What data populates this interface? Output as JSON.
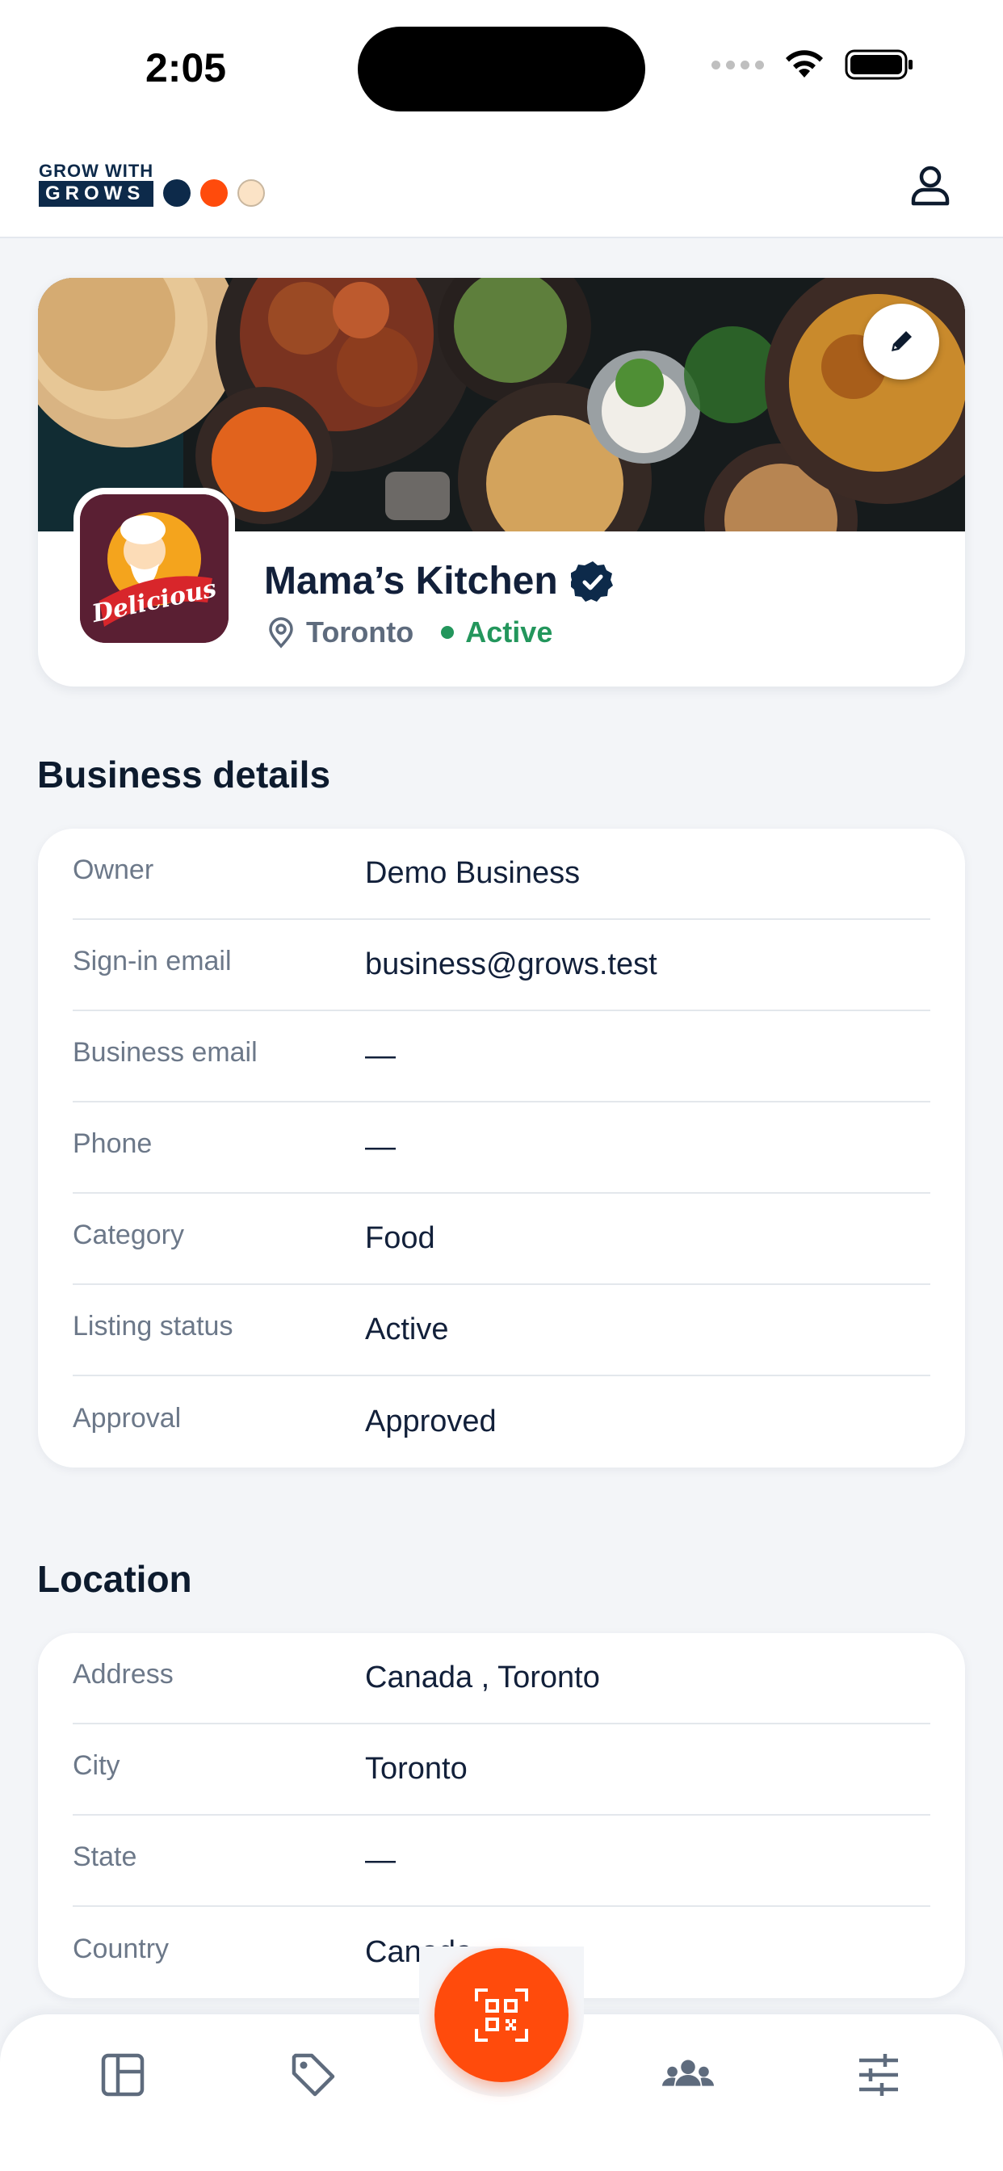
{
  "status_bar": {
    "time": "2:05"
  },
  "header": {
    "logo_top": "GROW WITH",
    "logo_bottom": "GROWS",
    "logo_dot_colors": [
      "#0d2a4a",
      "#ff4b0c",
      "#fbe3c6"
    ],
    "profile_icon": "user-icon"
  },
  "profile": {
    "name": "Mama’s Kitchen",
    "city": "Toronto",
    "status": "Active",
    "logo_text": "Delicious",
    "status_color": "#23965c"
  },
  "business_details": {
    "title": "Business details",
    "rows": [
      {
        "label": "Owner",
        "value": "Demo Business"
      },
      {
        "label": "Sign-in email",
        "value": "business@grows.test"
      },
      {
        "label": "Business email",
        "value": "—"
      },
      {
        "label": "Phone",
        "value": "—"
      },
      {
        "label": "Category",
        "value": "Food"
      },
      {
        "label": "Listing status",
        "value": "Active"
      },
      {
        "label": "Approval",
        "value": "Approved"
      }
    ]
  },
  "location": {
    "title": "Location",
    "rows": [
      {
        "label": "Address",
        "value": "Canada , Toronto"
      },
      {
        "label": "City",
        "value": "Toronto"
      },
      {
        "label": "State",
        "value": "—"
      },
      {
        "label": "Country",
        "value": "Canada"
      }
    ]
  },
  "bottom_nav": {
    "items": [
      "dashboard-icon",
      "tag-icon",
      "qr-scan-icon",
      "people-icon",
      "sliders-icon"
    ],
    "accent": "#ff4b0c"
  }
}
